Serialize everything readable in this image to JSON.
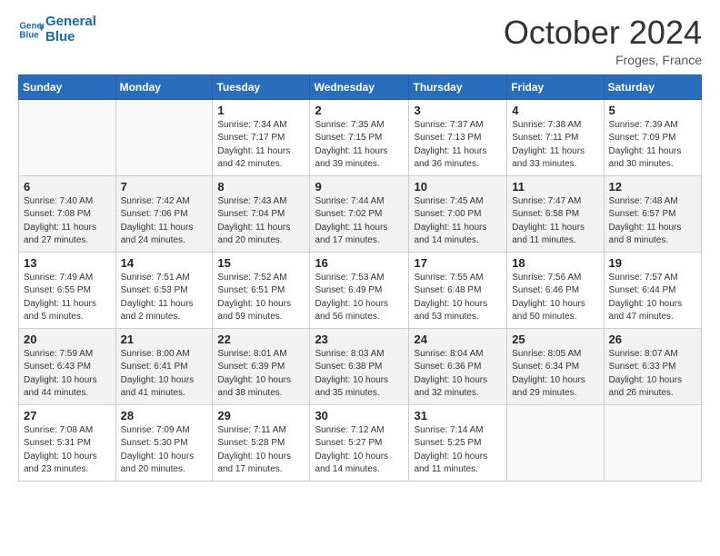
{
  "header": {
    "logo_line1": "General",
    "logo_line2": "Blue",
    "month": "October 2024",
    "location": "Froges, France"
  },
  "days_of_week": [
    "Sunday",
    "Monday",
    "Tuesday",
    "Wednesday",
    "Thursday",
    "Friday",
    "Saturday"
  ],
  "weeks": [
    [
      {
        "day": "",
        "info": ""
      },
      {
        "day": "",
        "info": ""
      },
      {
        "day": "1",
        "info": "Sunrise: 7:34 AM\nSunset: 7:17 PM\nDaylight: 11 hours and 42 minutes."
      },
      {
        "day": "2",
        "info": "Sunrise: 7:35 AM\nSunset: 7:15 PM\nDaylight: 11 hours and 39 minutes."
      },
      {
        "day": "3",
        "info": "Sunrise: 7:37 AM\nSunset: 7:13 PM\nDaylight: 11 hours and 36 minutes."
      },
      {
        "day": "4",
        "info": "Sunrise: 7:38 AM\nSunset: 7:11 PM\nDaylight: 11 hours and 33 minutes."
      },
      {
        "day": "5",
        "info": "Sunrise: 7:39 AM\nSunset: 7:09 PM\nDaylight: 11 hours and 30 minutes."
      }
    ],
    [
      {
        "day": "6",
        "info": "Sunrise: 7:40 AM\nSunset: 7:08 PM\nDaylight: 11 hours and 27 minutes."
      },
      {
        "day": "7",
        "info": "Sunrise: 7:42 AM\nSunset: 7:06 PM\nDaylight: 11 hours and 24 minutes."
      },
      {
        "day": "8",
        "info": "Sunrise: 7:43 AM\nSunset: 7:04 PM\nDaylight: 11 hours and 20 minutes."
      },
      {
        "day": "9",
        "info": "Sunrise: 7:44 AM\nSunset: 7:02 PM\nDaylight: 11 hours and 17 minutes."
      },
      {
        "day": "10",
        "info": "Sunrise: 7:45 AM\nSunset: 7:00 PM\nDaylight: 11 hours and 14 minutes."
      },
      {
        "day": "11",
        "info": "Sunrise: 7:47 AM\nSunset: 6:58 PM\nDaylight: 11 hours and 11 minutes."
      },
      {
        "day": "12",
        "info": "Sunrise: 7:48 AM\nSunset: 6:57 PM\nDaylight: 11 hours and 8 minutes."
      }
    ],
    [
      {
        "day": "13",
        "info": "Sunrise: 7:49 AM\nSunset: 6:55 PM\nDaylight: 11 hours and 5 minutes."
      },
      {
        "day": "14",
        "info": "Sunrise: 7:51 AM\nSunset: 6:53 PM\nDaylight: 11 hours and 2 minutes."
      },
      {
        "day": "15",
        "info": "Sunrise: 7:52 AM\nSunset: 6:51 PM\nDaylight: 10 hours and 59 minutes."
      },
      {
        "day": "16",
        "info": "Sunrise: 7:53 AM\nSunset: 6:49 PM\nDaylight: 10 hours and 56 minutes."
      },
      {
        "day": "17",
        "info": "Sunrise: 7:55 AM\nSunset: 6:48 PM\nDaylight: 10 hours and 53 minutes."
      },
      {
        "day": "18",
        "info": "Sunrise: 7:56 AM\nSunset: 6:46 PM\nDaylight: 10 hours and 50 minutes."
      },
      {
        "day": "19",
        "info": "Sunrise: 7:57 AM\nSunset: 6:44 PM\nDaylight: 10 hours and 47 minutes."
      }
    ],
    [
      {
        "day": "20",
        "info": "Sunrise: 7:59 AM\nSunset: 6:43 PM\nDaylight: 10 hours and 44 minutes."
      },
      {
        "day": "21",
        "info": "Sunrise: 8:00 AM\nSunset: 6:41 PM\nDaylight: 10 hours and 41 minutes."
      },
      {
        "day": "22",
        "info": "Sunrise: 8:01 AM\nSunset: 6:39 PM\nDaylight: 10 hours and 38 minutes."
      },
      {
        "day": "23",
        "info": "Sunrise: 8:03 AM\nSunset: 6:38 PM\nDaylight: 10 hours and 35 minutes."
      },
      {
        "day": "24",
        "info": "Sunrise: 8:04 AM\nSunset: 6:36 PM\nDaylight: 10 hours and 32 minutes."
      },
      {
        "day": "25",
        "info": "Sunrise: 8:05 AM\nSunset: 6:34 PM\nDaylight: 10 hours and 29 minutes."
      },
      {
        "day": "26",
        "info": "Sunrise: 8:07 AM\nSunset: 6:33 PM\nDaylight: 10 hours and 26 minutes."
      }
    ],
    [
      {
        "day": "27",
        "info": "Sunrise: 7:08 AM\nSunset: 5:31 PM\nDaylight: 10 hours and 23 minutes."
      },
      {
        "day": "28",
        "info": "Sunrise: 7:09 AM\nSunset: 5:30 PM\nDaylight: 10 hours and 20 minutes."
      },
      {
        "day": "29",
        "info": "Sunrise: 7:11 AM\nSunset: 5:28 PM\nDaylight: 10 hours and 17 minutes."
      },
      {
        "day": "30",
        "info": "Sunrise: 7:12 AM\nSunset: 5:27 PM\nDaylight: 10 hours and 14 minutes."
      },
      {
        "day": "31",
        "info": "Sunrise: 7:14 AM\nSunset: 5:25 PM\nDaylight: 10 hours and 11 minutes."
      },
      {
        "day": "",
        "info": ""
      },
      {
        "day": "",
        "info": ""
      }
    ]
  ]
}
